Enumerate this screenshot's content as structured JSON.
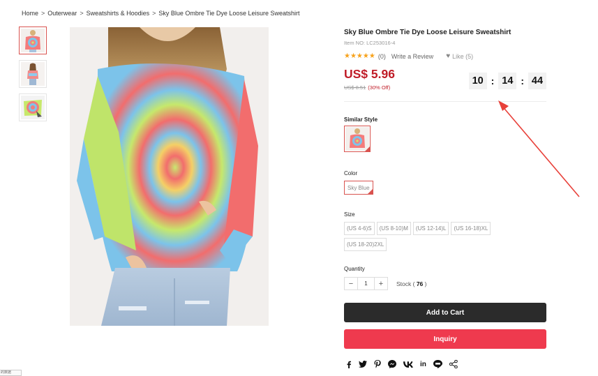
{
  "breadcrumb": {
    "items": [
      "Home",
      "Outerwear",
      "Sweatshirts & Hoodies",
      "Sky Blue Ombre Tie Dye Loose Leisure Sweatshirt"
    ],
    "separator": ">"
  },
  "product": {
    "title": "Sky Blue Ombre Tie Dye Loose Leisure Sweatshirt",
    "item_no": "Item NO: LC253016-4",
    "stars": "★★★★★",
    "review_count": "(0)",
    "write_review": "Write a Review",
    "like": "Like (5)",
    "price": "US$ 5.96",
    "old_price": "US$ 8.51",
    "discount": "(30% Off)"
  },
  "countdown": {
    "hours": "10",
    "minutes": "14",
    "seconds": "44",
    "separator": ":"
  },
  "similar": {
    "label": "Similar Style"
  },
  "color": {
    "label": "Color",
    "selected": "Sky Blue"
  },
  "size": {
    "label": "Size",
    "options": [
      "(US 4-6)S",
      "(US 8-10)M",
      "(US 12-14)L",
      "(US 16-18)XL",
      "(US 18-20)2XL"
    ]
  },
  "quantity": {
    "label": "Quantity",
    "value": "1",
    "minus": "−",
    "plus": "+",
    "stock_prefix": "Stock (",
    "stock_value": "76",
    "stock_suffix": ")"
  },
  "buttons": {
    "add_to_cart": "Add to Cart",
    "inquiry": "Inquiry"
  },
  "share": {
    "icons": [
      "facebook-icon",
      "twitter-icon",
      "pinterest-icon",
      "messenger-icon",
      "vk-icon",
      "linkedin-icon",
      "line-icon",
      "share-icon"
    ],
    "linkedin_text": "in"
  },
  "corner_tag": {
    "text": "的数据"
  },
  "colors": {
    "price_red": "#c01d28",
    "accent_red": "#d9534f",
    "cart_button": "#2b2b2b",
    "inquiry_button": "#ef3a4e",
    "star": "#f7a21b",
    "arrow": "#e8413a"
  }
}
